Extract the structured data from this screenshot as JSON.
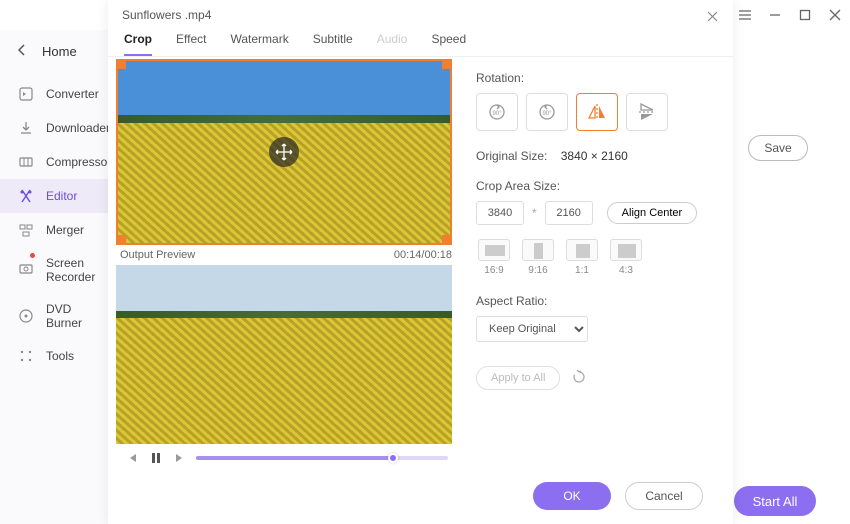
{
  "titlebar": {},
  "sidebar": {
    "home": "Home",
    "items": [
      {
        "label": "Converter",
        "icon": "converter-icon"
      },
      {
        "label": "Downloader",
        "icon": "downloader-icon"
      },
      {
        "label": "Compressor",
        "icon": "compressor-icon"
      },
      {
        "label": "Editor",
        "icon": "editor-icon",
        "active": true
      },
      {
        "label": "Merger",
        "icon": "merger-icon"
      },
      {
        "label": "Screen Recorder",
        "icon": "screen-recorder-icon",
        "has_dot": true
      },
      {
        "label": "DVD Burner",
        "icon": "dvd-burner-icon"
      },
      {
        "label": "Tools",
        "icon": "tools-icon"
      }
    ]
  },
  "content": {
    "save_label": "Save",
    "start_all_label": "Start All"
  },
  "dialog": {
    "title": "Sunflowers .mp4",
    "tabs": [
      {
        "label": "Crop",
        "active": true
      },
      {
        "label": "Effect"
      },
      {
        "label": "Watermark"
      },
      {
        "label": "Subtitle"
      },
      {
        "label": "Audio",
        "disabled": true
      },
      {
        "label": "Speed"
      }
    ],
    "preview": {
      "output_label": "Output Preview",
      "time": "00:14/00:18",
      "seek_percent": 78
    },
    "settings": {
      "rotation_label": "Rotation:",
      "rotation_options": [
        {
          "name": "rotate-cw-90",
          "label": "90°"
        },
        {
          "name": "rotate-ccw-90",
          "label": "90°"
        },
        {
          "name": "flip-horizontal",
          "active": true
        },
        {
          "name": "flip-vertical"
        }
      ],
      "original_size_label": "Original Size:",
      "original_size_value": "3840 × 2160",
      "crop_area_label": "Crop Area Size:",
      "crop_w": "3840",
      "crop_h": "2160",
      "align_center_label": "Align Center",
      "ratios": [
        {
          "label": "16:9",
          "cls": "r169"
        },
        {
          "label": "9:16",
          "cls": "r916"
        },
        {
          "label": "1:1",
          "cls": "r11"
        },
        {
          "label": "4:3",
          "cls": "r43"
        }
      ],
      "aspect_label": "Aspect Ratio:",
      "aspect_value": "Keep Original",
      "apply_all_label": "Apply to All"
    },
    "footer": {
      "ok_label": "OK",
      "cancel_label": "Cancel"
    }
  }
}
